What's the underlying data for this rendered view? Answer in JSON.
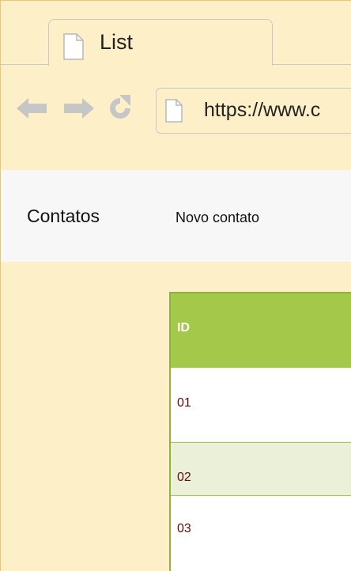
{
  "browser": {
    "tab_title": "List",
    "address": "https://www.c",
    "page_icon": "page-icon",
    "nav_icons": [
      "back-arrow-icon",
      "forward-arrow-icon",
      "reload-icon"
    ]
  },
  "app": {
    "brand": "Contatos",
    "nav_link": "Novo contato"
  },
  "table": {
    "header": "ID",
    "rows": [
      "01",
      "02",
      "03"
    ]
  },
  "colors": {
    "background": "#fdf0c8",
    "header_green": "#a4c94a",
    "row_alt": "#eaf1d8",
    "cell_text": "#5b0d0d"
  }
}
